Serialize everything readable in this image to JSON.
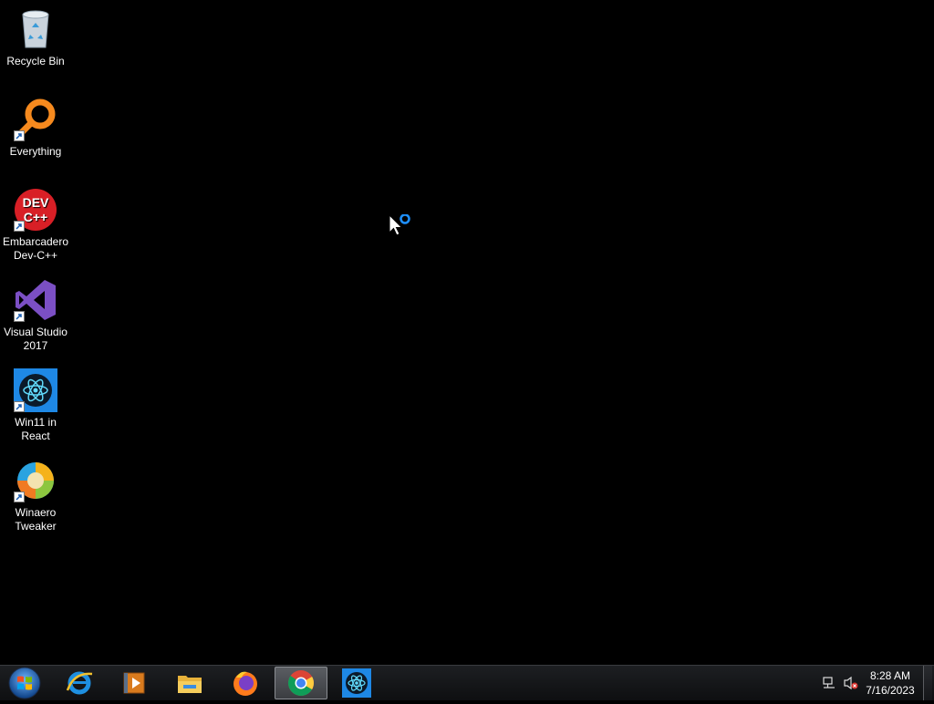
{
  "desktop": {
    "icons": [
      {
        "label": "Recycle Bin",
        "icon": "recycle-bin-icon"
      },
      {
        "label": "Everything",
        "icon": "everything-search-icon"
      },
      {
        "label": "Embarcadero Dev-C++",
        "icon": "dev-cpp-icon",
        "icon_text": "DEV C++"
      },
      {
        "label": "Visual Studio 2017",
        "icon": "visual-studio-icon"
      },
      {
        "label": "Win11 in React",
        "icon": "react-atom-icon"
      },
      {
        "label": "Winaero Tweaker",
        "icon": "winaero-tweaker-icon"
      }
    ]
  },
  "taskbar": {
    "start": {
      "icon": "windows-start-orb-icon"
    },
    "pinned": [
      {
        "name": "Internet Explorer",
        "icon": "internet-explorer-icon",
        "active": false
      },
      {
        "name": "Windows Media Player",
        "icon": "media-player-icon",
        "active": false
      },
      {
        "name": "File Explorer",
        "icon": "file-explorer-icon",
        "active": false
      },
      {
        "name": "Firefox",
        "icon": "firefox-icon",
        "active": false
      },
      {
        "name": "Google Chrome",
        "icon": "chrome-icon",
        "active": true
      },
      {
        "name": "Win11 in React",
        "icon": "react-atom-icon",
        "active": false
      }
    ],
    "tray": {
      "network_icon": "network-icon",
      "volume_icon": "volume-muted-icon",
      "time": "8:28 AM",
      "date": "7/16/2023"
    }
  },
  "colors": {
    "desktop_bg": "#000000",
    "taskbar_bg": "#141518",
    "active_button": "#4a4d52",
    "accent_blue": "#1e90ff"
  }
}
